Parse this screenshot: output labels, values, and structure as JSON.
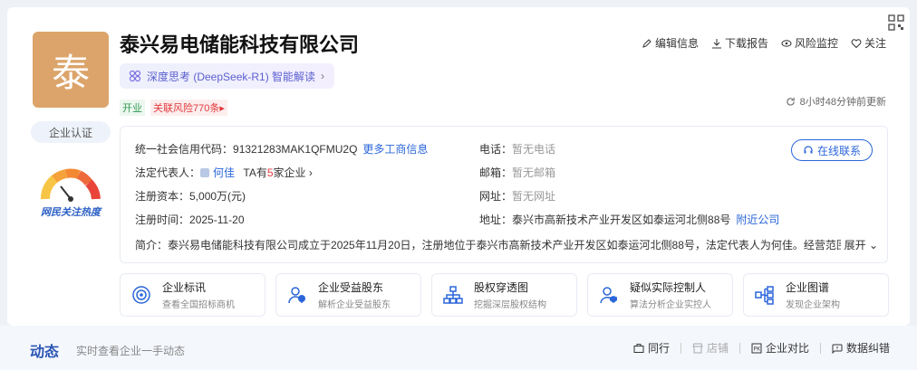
{
  "company": {
    "logo_char": "泰",
    "name": "泰兴易电储能科技有限公司",
    "certification": "企业认证",
    "heat_label": "网民关注热度"
  },
  "ai": {
    "label": "深度思考 (DeepSeek-R1) 智能解读",
    "chevron": "›"
  },
  "tags": {
    "status": "开业",
    "risk": "关联风险770条",
    "risk_arrow": "▸"
  },
  "actions": [
    {
      "label": "编辑信息",
      "icon": "edit-icon"
    },
    {
      "label": "下载报告",
      "icon": "download-icon"
    },
    {
      "label": "风险监控",
      "icon": "eye-icon"
    },
    {
      "label": "关注",
      "icon": "heart-icon"
    }
  ],
  "updated": "8小时48分钟前更新",
  "info": {
    "credit_code_label": "统一社会信用代码：",
    "credit_code": "91321283MAK1QFMU2Q",
    "more_info": "更多工商信息",
    "legal_rep_label": "法定代表人：",
    "legal_rep": "何佳",
    "legal_rep_extra_prefix": "TA有",
    "legal_rep_extra_count": "5",
    "legal_rep_extra_suffix": "家企业",
    "capital_label": "注册资本：",
    "capital": "5,000万(元)",
    "reg_date_label": "注册时间：",
    "reg_date": "2025-11-20",
    "phone_label": "电话：",
    "phone": "暂无电话",
    "email_label": "邮箱：",
    "email": "暂无邮箱",
    "website_label": "网址：",
    "website": "暂无网址",
    "address_label": "地址：",
    "address": "泰兴市高新技术产业开发区如泰运河北侧88号",
    "nearby": "附近公司",
    "online_contact": "在线联系",
    "intro_label": "简介：",
    "intro": "泰兴易电储能科技有限公司成立于2025年11月20日，注册地位于泰兴市高新技术产业开发区如泰运河北侧88号，法定代表人为何佳。经营范围",
    "expand": "展开"
  },
  "features": [
    {
      "title": "企业标讯",
      "sub": "查看全国招标商机",
      "icon": "target-icon"
    },
    {
      "title": "企业受益股东",
      "sub": "解析企业受益股东",
      "icon": "shareholder-icon"
    },
    {
      "title": "股权穿透图",
      "sub": "挖掘深层股权结构",
      "icon": "org-chart-icon"
    },
    {
      "title": "疑似实际控制人",
      "sub": "算法分析企业实控人",
      "icon": "controller-icon"
    },
    {
      "title": "企业图谱",
      "sub": "发现企业架构",
      "icon": "graph-icon"
    }
  ],
  "dynamics": {
    "title": "动态",
    "sub": "实时查看企业一手动态"
  },
  "bottom_actions": [
    {
      "label": "同行",
      "icon": "briefcase-icon",
      "enabled": true
    },
    {
      "label": "店铺",
      "icon": "store-icon",
      "enabled": false
    },
    {
      "label": "企业对比",
      "icon": "compare-icon",
      "enabled": true
    },
    {
      "label": "数据纠错",
      "icon": "report-icon",
      "enabled": true
    }
  ],
  "colors": {
    "accent": "#2b66d9",
    "logo_bg": "#dca46a",
    "risk": "#e2383b",
    "open": "#2f9b52"
  }
}
